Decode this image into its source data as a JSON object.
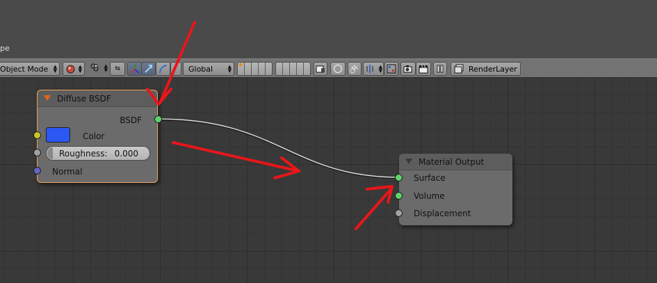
{
  "header": {
    "fragment_text": "pe"
  },
  "toolbar": {
    "mode_label": "Object Mode",
    "orientation_label": "Global",
    "render_layer_label": "RenderLayer"
  },
  "nodes": {
    "diffuse": {
      "title": "Diffuse BSDF",
      "output_label": "BSDF",
      "color_label": "Color",
      "color_value": "#2b58f2",
      "roughness_label": "Roughness:",
      "roughness_value": "0.000",
      "normal_label": "Normal"
    },
    "material_output": {
      "title": "Material Output",
      "surface_label": "Surface",
      "volume_label": "Volume",
      "displacement_label": "Displacement"
    }
  },
  "colors": {
    "shader_socket": "#5fd36a",
    "color_socket": "#c7c729",
    "value_socket": "#a1a1a1",
    "vector_socket": "#6363c7",
    "selected_outline": "#f0a45a",
    "annotation_arrow": "#e8161b",
    "link": "#e6e6e6"
  }
}
